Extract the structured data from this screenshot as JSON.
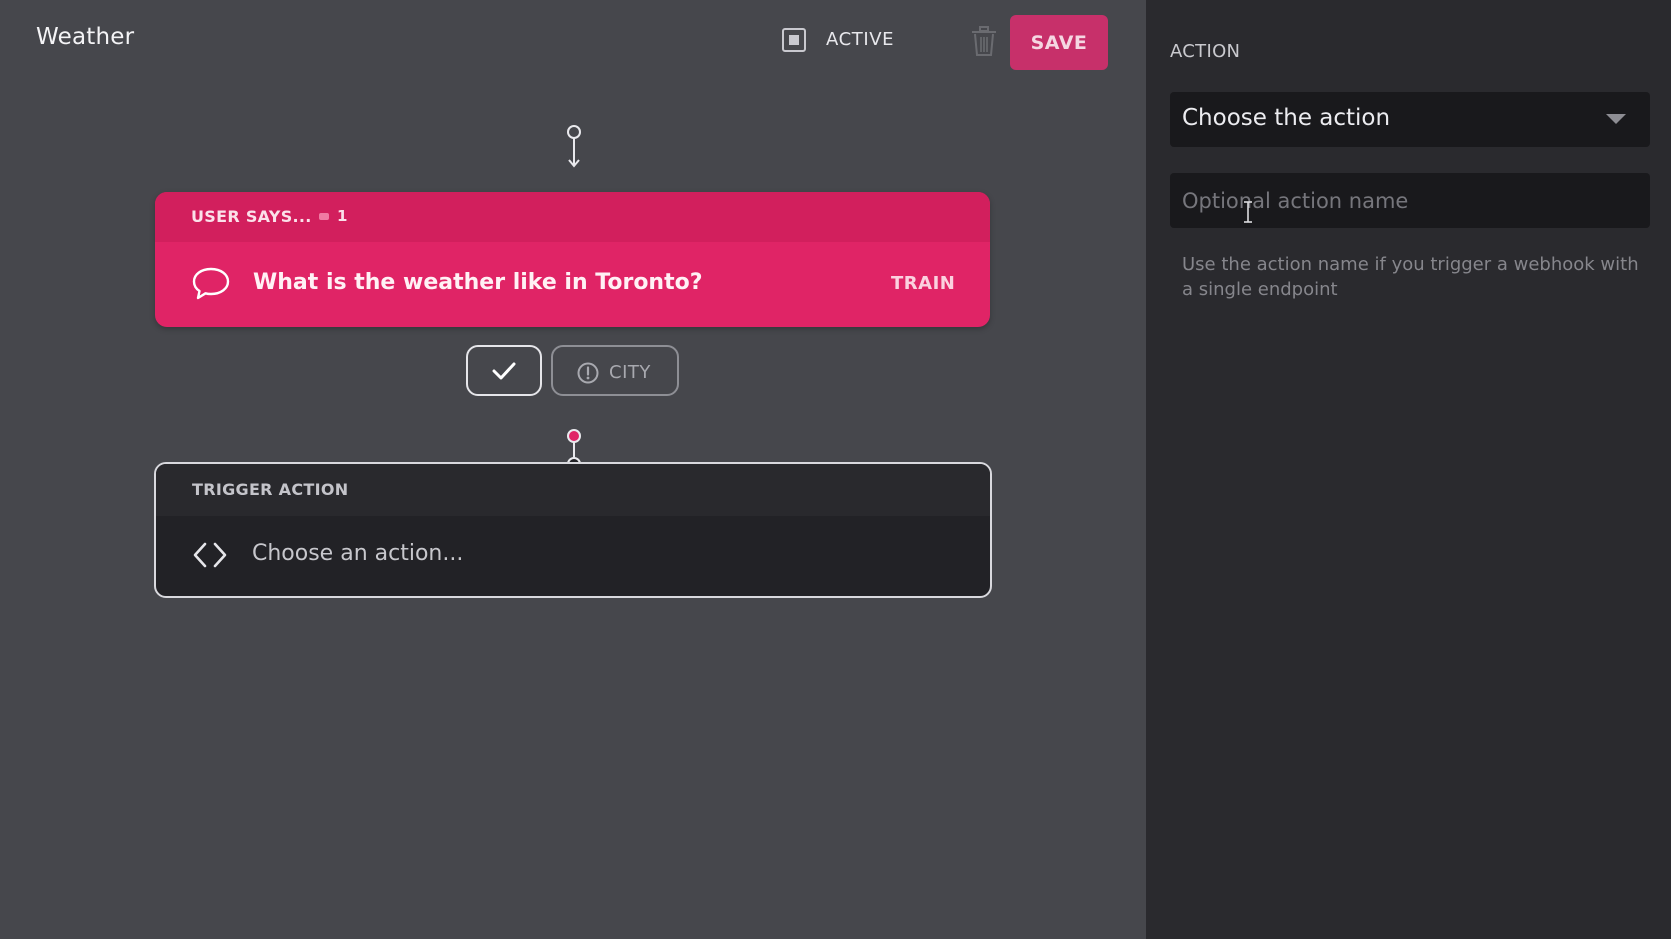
{
  "header": {
    "title": "Weather",
    "active_label": "ACTIVE",
    "save_label": "SAVE"
  },
  "user_says": {
    "label": "USER SAYS...",
    "count": "1",
    "phrase": "What is the weather like in Toronto?",
    "train_label": "TRAIN"
  },
  "parameters": {
    "city_label": "CITY"
  },
  "trigger": {
    "label": "TRIGGER ACTION",
    "placeholder": "Choose an action..."
  },
  "panel": {
    "heading": "ACTION",
    "select_value": "Choose the action",
    "name_placeholder": "Optional action name",
    "hint": "Use the action name if you trigger a webhook with a single endpoint"
  },
  "colors": {
    "accent": "#e02466",
    "canvas_bg": "#46474c",
    "panel_bg": "#2a2a2e"
  },
  "icons": {
    "active": "checkbox-icon",
    "delete": "trash-icon",
    "message": "speech-bubble-icon",
    "confirm": "checkmark-icon",
    "warning": "exclamation-circle-icon",
    "code": "code-brackets-icon",
    "dropdown": "chevron-down-icon"
  }
}
